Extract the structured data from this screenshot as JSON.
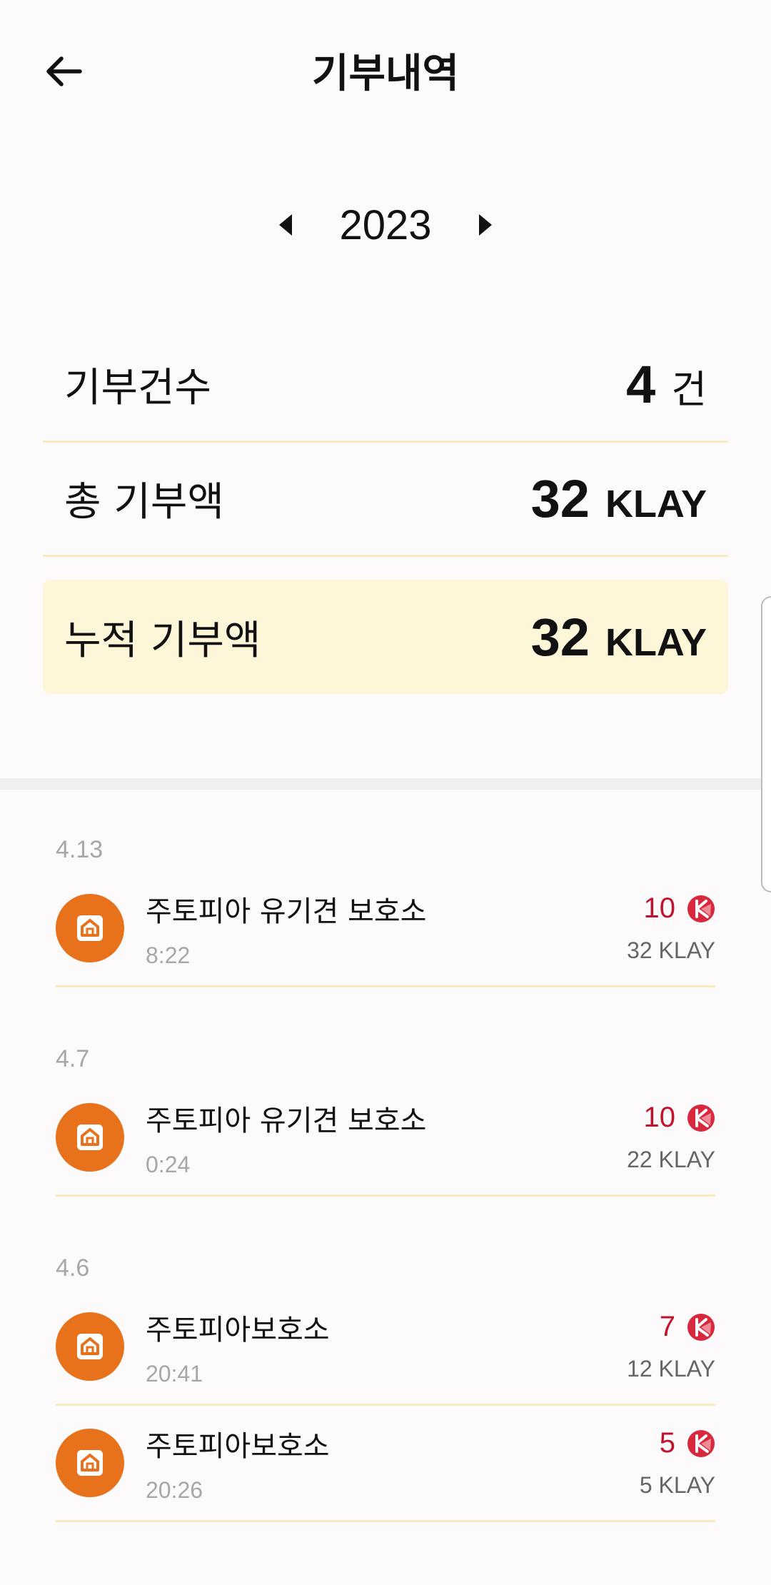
{
  "header": {
    "title": "기부내역"
  },
  "year": {
    "value": "2023"
  },
  "summary": {
    "count_label": "기부건수",
    "count_value": "4",
    "count_unit": "건",
    "total_label": "총 기부액",
    "total_value": "32",
    "total_unit": "KLAY",
    "cumulative_label": "누적 기부액",
    "cumulative_value": "32",
    "cumulative_unit": "KLAY"
  },
  "history": [
    {
      "date": "4.13",
      "items": [
        {
          "name": "주토피아 유기견 보호소",
          "time": "8:22",
          "amount": "10",
          "running_total": "32 KLAY"
        }
      ]
    },
    {
      "date": "4.7",
      "items": [
        {
          "name": "주토피아 유기견 보호소",
          "time": "0:24",
          "amount": "10",
          "running_total": "22 KLAY"
        }
      ]
    },
    {
      "date": "4.6",
      "items": [
        {
          "name": "주토피아보호소",
          "time": "20:41",
          "amount": "7",
          "running_total": "12 KLAY"
        },
        {
          "name": "주토피아보호소",
          "time": "20:26",
          "amount": "5",
          "running_total": "5 KLAY"
        }
      ]
    }
  ],
  "icons": {
    "back": "arrow-left-icon",
    "prev": "triangle-left-icon",
    "next": "triangle-right-icon",
    "shelter": "house-icon",
    "token": "klay-token-icon"
  },
  "colors": {
    "accent_orange": "#e8721c",
    "amount_red": "#c0122a",
    "highlight_bg": "#fdf6d8",
    "row_border": "#f7edbe"
  }
}
